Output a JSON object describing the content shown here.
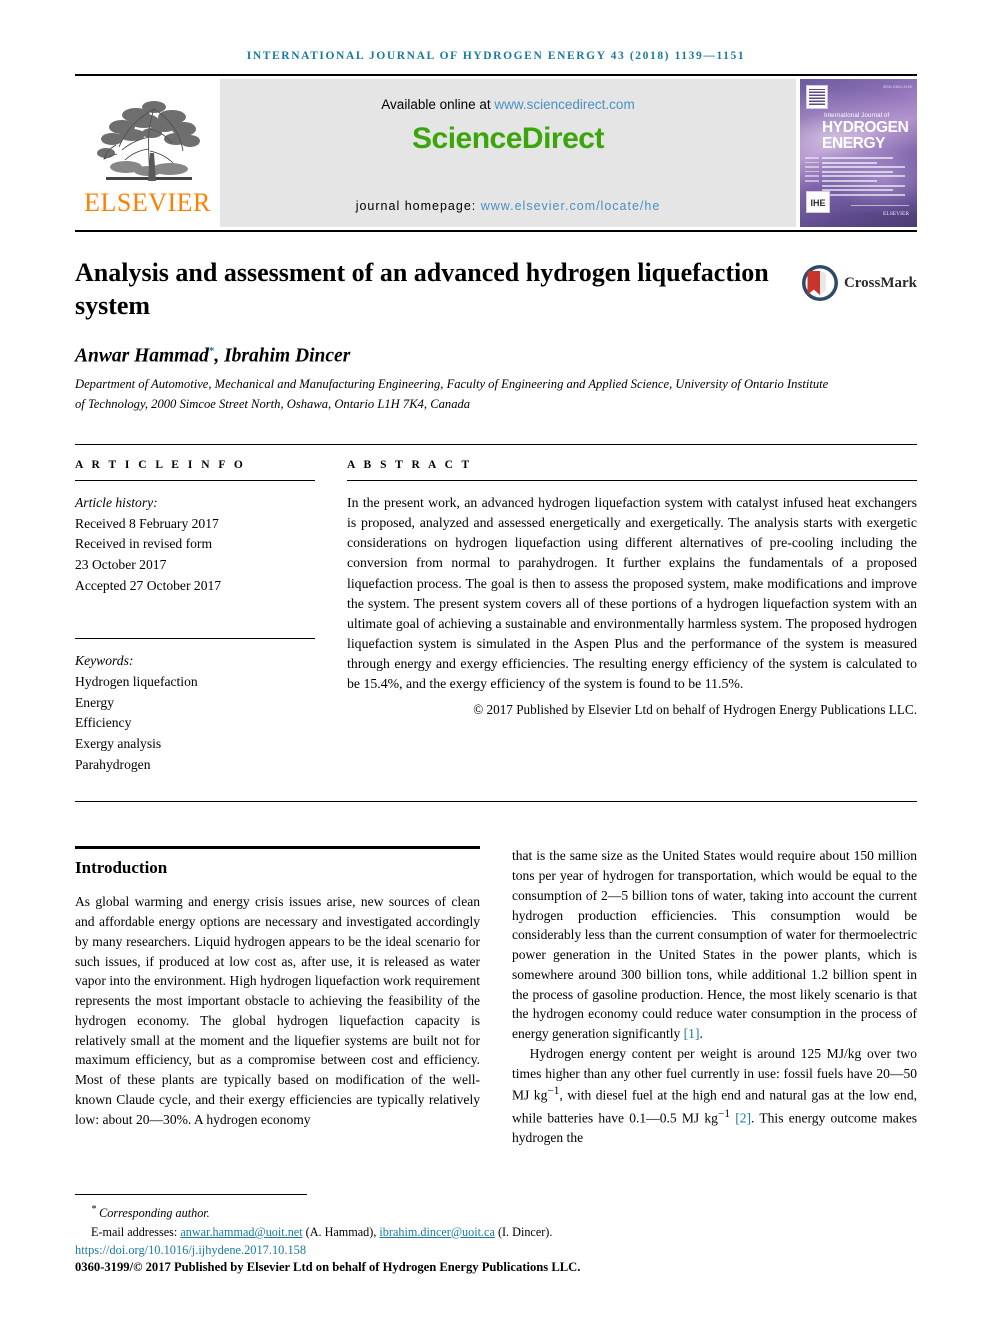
{
  "running_head": "INTERNATIONAL JOURNAL OF HYDROGEN ENERGY 43 (2018) 1139—1151",
  "masthead": {
    "publisher_logo_name": "elsevier-tree-logo",
    "publisher_word": "ELSEVIER",
    "available_prefix": "Available online at ",
    "available_url": "www.sciencedirect.com",
    "sciencedirect_logo": "ScienceDirect",
    "homepage_prefix": "journal homepage: ",
    "homepage_url": "www.elsevier.com/locate/he",
    "cover": {
      "supertitle": "International Journal of",
      "title_line1": "HYDROGEN",
      "title_line2": "ENERGY",
      "issn_corner": "ISSN 0360-3199",
      "badge": "IHE",
      "publisher": "ELSEVIER"
    }
  },
  "article": {
    "title": "Analysis and assessment of an advanced hydrogen liquefaction system",
    "crossmark_label": "CrossMark",
    "authors": "Anwar Hammad",
    "authors_marker": "*",
    "authors_rest": ", Ibrahim Dincer",
    "affiliation": "Department of Automotive, Mechanical and Manufacturing Engineering, Faculty of Engineering and Applied Science, University of Ontario Institute of Technology, 2000 Simcoe Street North, Oshawa, Ontario L1H 7K4, Canada"
  },
  "article_info": {
    "heading": "A R T I C L E  I N F O",
    "history_label": "Article history:",
    "received": "Received 8 February 2017",
    "revised_label": "Received in revised form",
    "revised_date": "23 October 2017",
    "accepted": "Accepted 27 October 2017",
    "keywords_label": "Keywords:",
    "keywords": [
      "Hydrogen liquefaction",
      "Energy",
      "Efficiency",
      "Exergy analysis",
      "Parahydrogen"
    ]
  },
  "abstract": {
    "heading": "A B S T R A C T",
    "text": "In the present work, an advanced hydrogen liquefaction system with catalyst infused heat exchangers is proposed, analyzed and assessed energetically and exergetically. The analysis starts with exergetic considerations on hydrogen liquefaction using different alternatives of pre-cooling including the conversion from normal to parahydrogen. It further explains the fundamentals of a proposed liquefaction process. The goal is then to assess the proposed system, make modifications and improve the system. The present system covers all of these portions of a hydrogen liquefaction system with an ultimate goal of achieving a sustainable and environmentally harmless system. The proposed hydrogen liquefaction system is simulated in the Aspen Plus and the performance of the system is measured through energy and exergy efficiencies. The resulting energy efficiency of the system is calculated to be 15.4%, and the exergy efficiency of the system is found to be 11.5%.",
    "copyright": "© 2017 Published by Elsevier Ltd on behalf of Hydrogen Energy Publications LLC."
  },
  "introduction": {
    "heading": "Introduction",
    "left_para1": "As global warming and energy crisis issues arise, new sources of clean and affordable energy options are necessary and investigated accordingly by many researchers. Liquid hydrogen appears to be the ideal scenario for such issues, if produced at low cost as, after use, it is released as water vapor into the environment. High hydrogen liquefaction work requirement represents the most important obstacle to achieving the feasibility of the hydrogen economy. The global hydrogen liquefaction capacity is relatively small at the moment and the liquefier systems are built not for maximum efficiency, but as a compromise between cost and efficiency. Most of these plants are typically based on modification of the well-known Claude cycle, and their exergy efficiencies are typically relatively low: about 20—30%. A hydrogen economy",
    "right_para1_a": "that is the same size as the United States would require about 150 million tons per year of hydrogen for transportation, which would be equal to the consumption of 2—5 billion tons of water, taking into account the current hydrogen production efficiencies. This consumption would be considerably less than the current consumption of water for thermoelectric power generation in the United States in the power plants, which is somewhere around 300 billion tons, while additional 1.2 billion spent in the process of gasoline production. Hence, the most likely scenario is that the hydrogen economy could reduce water consumption in the process of energy generation significantly ",
    "right_para1_ref": "[1]",
    "right_para1_b": ".",
    "right_para2_a": "Hydrogen energy content per weight is around 125 MJ/kg over two times higher than any other fuel currently in use: fossil fuels have 20—50 MJ kg",
    "right_para2_sup1": "−1",
    "right_para2_b": ", with diesel fuel at the high end and natural gas at the low end, while batteries have 0.1—0.5 MJ kg",
    "right_para2_sup2": "−1",
    "right_para2_c": " ",
    "right_para2_ref": "[2]",
    "right_para2_d": ". This energy outcome makes hydrogen the"
  },
  "footer": {
    "corresponding_marker": "*",
    "corresponding_text": "Corresponding author.",
    "email_label": "E-mail addresses: ",
    "email1": "anwar.hammad@uoit.net",
    "email1_name": " (A. Hammad), ",
    "email2": "ibrahim.dincer@uoit.ca",
    "email2_name": " (I. Dincer).",
    "doi": "https://doi.org/10.1016/j.ijhydene.2017.10.158",
    "issn_copyright": "0360-3199/© 2017 Published by Elsevier Ltd on behalf of Hydrogen Energy Publications LLC."
  },
  "colors": {
    "journal_teal": "#1a7a9e",
    "sciencedirect_green": "#3aa60a",
    "elsevier_orange": "#ff7f00",
    "link_blue": "#4a90c4",
    "crossmark_red": "#c8332a",
    "cover_purple": "#6c5a9e"
  }
}
